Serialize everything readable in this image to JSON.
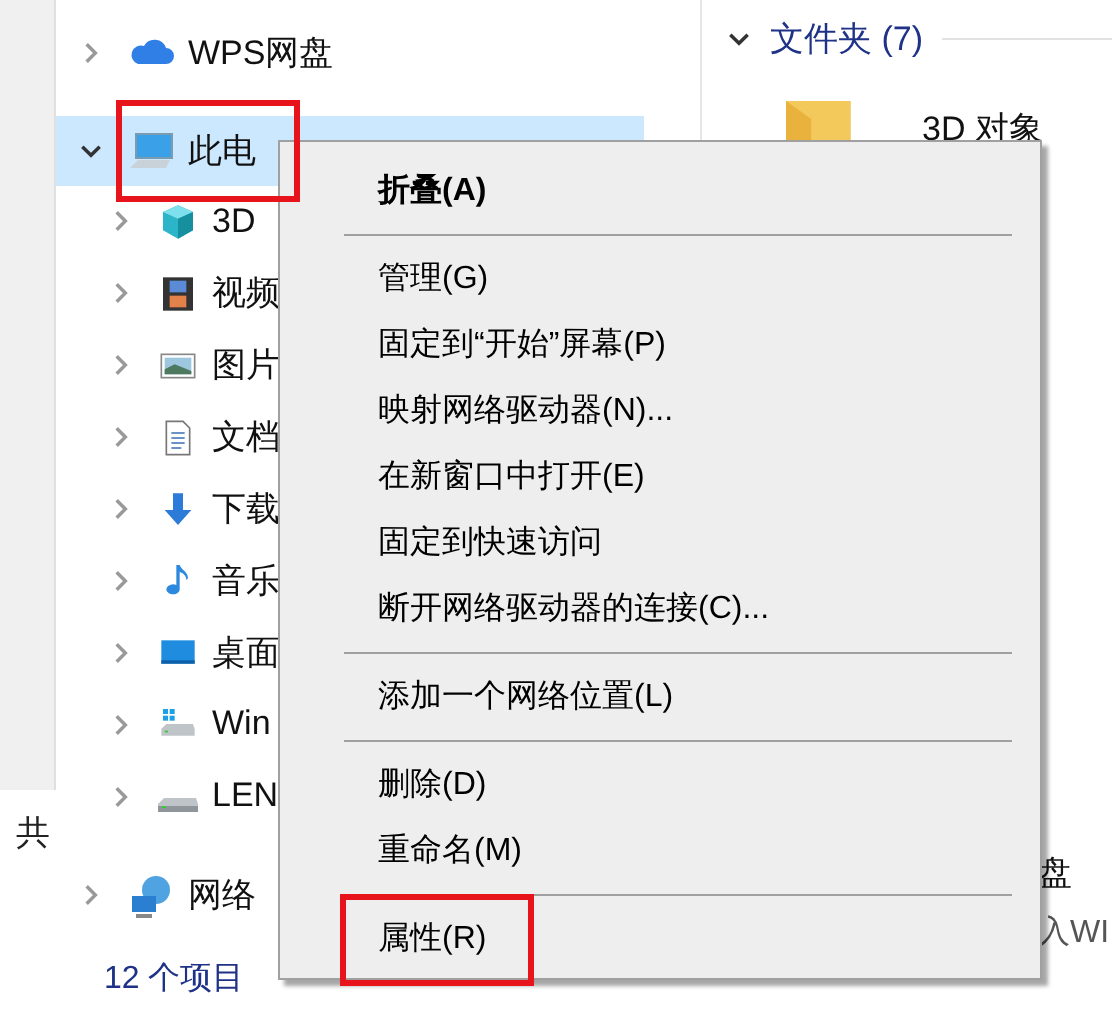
{
  "left_strip": {
    "text": "共"
  },
  "nav": {
    "items": [
      {
        "label": "WPS网盘",
        "kind": "cloud",
        "expanded": false,
        "selected": false
      },
      {
        "label": "此电",
        "kind": "pc",
        "expanded": true,
        "selected": true,
        "children": [
          {
            "label": "3D",
            "kind": "cube",
            "expanded": false
          },
          {
            "label": "视频",
            "kind": "video",
            "expanded": false
          },
          {
            "label": "图片",
            "kind": "image",
            "expanded": false
          },
          {
            "label": "文档",
            "kind": "document",
            "expanded": false
          },
          {
            "label": "下载",
            "kind": "download",
            "expanded": false
          },
          {
            "label": "音乐",
            "kind": "music",
            "expanded": false
          },
          {
            "label": "桌面",
            "kind": "desktop",
            "expanded": false
          },
          {
            "label": "Win",
            "kind": "windows-drive",
            "expanded": false
          },
          {
            "label": "LEN",
            "kind": "drive",
            "expanded": false
          }
        ]
      },
      {
        "label": "网络",
        "kind": "network",
        "expanded": false,
        "selected": false
      }
    ]
  },
  "status_bar": {
    "text": "12 个项目"
  },
  "content": {
    "group_title": "文件夹 (7)",
    "expanded": true,
    "item": "3D 对象",
    "bottom_texts": [
      "盘",
      "入WI"
    ]
  },
  "context_menu": {
    "items": [
      {
        "kind": "item",
        "label": "折叠(A)",
        "default": true
      },
      {
        "kind": "separator"
      },
      {
        "kind": "item",
        "label": "管理(G)",
        "default": false
      },
      {
        "kind": "item",
        "label": "固定到“开始”屏幕(P)",
        "default": false
      },
      {
        "kind": "item",
        "label": "映射网络驱动器(N)...",
        "default": false
      },
      {
        "kind": "item",
        "label": "在新窗口中打开(E)",
        "default": false
      },
      {
        "kind": "item",
        "label": "固定到快速访问",
        "default": false
      },
      {
        "kind": "item",
        "label": "断开网络驱动器的连接(C)...",
        "default": false
      },
      {
        "kind": "separator"
      },
      {
        "kind": "item",
        "label": "添加一个网络位置(L)",
        "default": false
      },
      {
        "kind": "separator"
      },
      {
        "kind": "item",
        "label": "删除(D)",
        "default": false
      },
      {
        "kind": "item",
        "label": "重命名(M)",
        "default": false
      },
      {
        "kind": "separator"
      },
      {
        "kind": "item",
        "label": "属性(R)",
        "default": false
      }
    ]
  },
  "annotations": [
    {
      "kind": "highlight-box"
    },
    {
      "kind": "highlight-box"
    }
  ]
}
